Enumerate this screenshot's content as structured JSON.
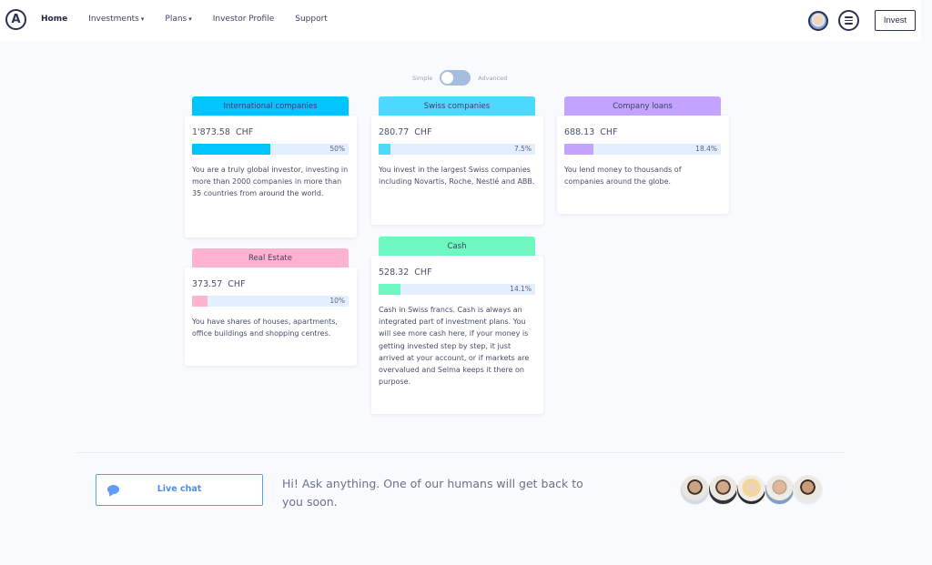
{
  "header": {
    "logo_letter": "A",
    "nav": [
      {
        "label": "Home",
        "active": true,
        "dropdown": false
      },
      {
        "label": "Investments",
        "active": false,
        "dropdown": true
      },
      {
        "label": "Plans",
        "active": false,
        "dropdown": true
      },
      {
        "label": "Investor Profile",
        "active": false,
        "dropdown": false
      },
      {
        "label": "Support",
        "active": false,
        "dropdown": false
      }
    ],
    "caret_glyph": "▾",
    "user_avatar_icon": "user-avatar",
    "menu_icon": "hamburger-circle",
    "invest_label": "Invest"
  },
  "mode_toggle": {
    "left_label": "Simple",
    "right_label": "Advanced",
    "state": "simple"
  },
  "allocations": [
    {
      "title": "International companies",
      "amount": "1'873.58",
      "currency": "CHF",
      "percent_label": "50%",
      "percent": 50,
      "color": "#00c4ff",
      "description": "You are a truly global investor, investing in more than 2000 companies in more than 35 countries from around the world."
    },
    {
      "title": "Swiss companies",
      "amount": "280.77",
      "currency": "CHF",
      "percent_label": "7.5%",
      "percent": 7.5,
      "color": "#4dd8ff",
      "description": "You invest in the largest Swiss companies including Novartis, Roche, Nestlé and ABB."
    },
    {
      "title": "Company loans",
      "amount": "688.13",
      "currency": "CHF",
      "percent_label": "18.4%",
      "percent": 18.4,
      "color": "#c4a2ff",
      "description": "You lend money to thousands of companies around the globe."
    },
    {
      "title": "Real Estate",
      "amount": "373.57",
      "currency": "CHF",
      "percent_label": "10%",
      "percent": 10,
      "color": "#ffb3d0",
      "description": "You have shares of houses, apartments, office buildings and shopping centres."
    },
    {
      "title": "Cash",
      "amount": "528.32",
      "currency": "CHF",
      "percent_label": "14.1%",
      "percent": 14.1,
      "color": "#6ef7bf",
      "description": "Cash in Swiss francs. Cash is always an integrated part of investment plans. You will see more cash here, if your money is getting invested step by step, it just arrived at your account, or if markets are overvalued and Selma keeps it there on purpose."
    }
  ],
  "support": {
    "chat_label": "Live chat",
    "chat_icon": "speech-bubble",
    "message": "Hi! Ask anything. One of our humans will get back to you soon.",
    "team_avatars": 5
  }
}
